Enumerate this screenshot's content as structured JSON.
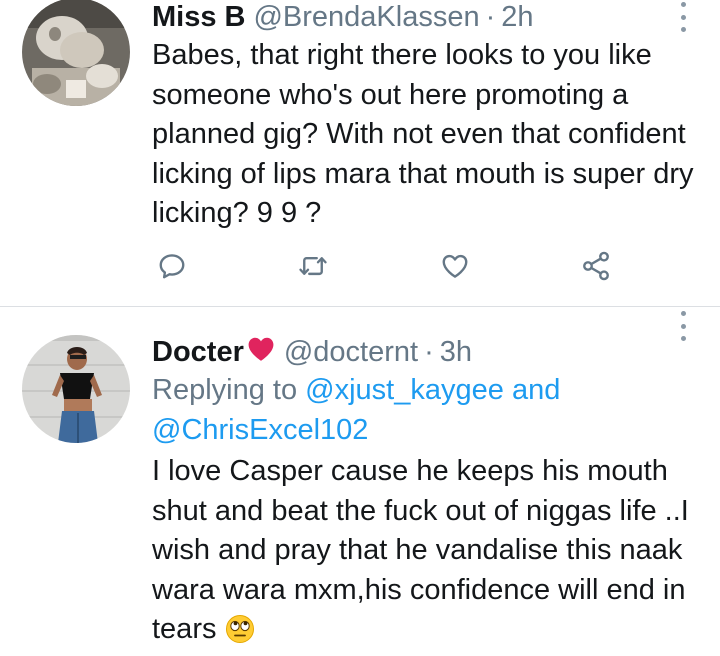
{
  "tweets": [
    {
      "name": "Miss B",
      "handle": "@BrendaKlassen",
      "separator": "·",
      "time": "2h",
      "text": "Babes, that right there looks to you like someone who's out here promoting a planned gig? With not even that confident licking of lips mara that mouth is super dry licking? 9 9 ?",
      "actions": [
        "reply-icon",
        "retweet-icon",
        "like-icon",
        "share-icon"
      ]
    },
    {
      "name": "Docter",
      "name_emoji": "red-heart-icon",
      "handle": "@docternt",
      "separator": "·",
      "time": "3h",
      "replying_prefix": "Replying to",
      "replying_to_1": "@xjust_kaygee",
      "replying_and": "and",
      "replying_to_2": "@ChrisExcel102",
      "text": "I love Casper cause he keeps his mouth shut and beat the fuck out of niggas life ..I wish and pray that he vandalise this naak wara wara mxm,his confidence will end in tears",
      "text_emoji": "eye-roll-emoji-icon"
    }
  ],
  "colors": {
    "text": "#14171a",
    "secondary": "#657786",
    "link": "#1d9bf0",
    "icon": "#657786",
    "heart": "#e0245e",
    "divider": "#dcdfe3"
  }
}
